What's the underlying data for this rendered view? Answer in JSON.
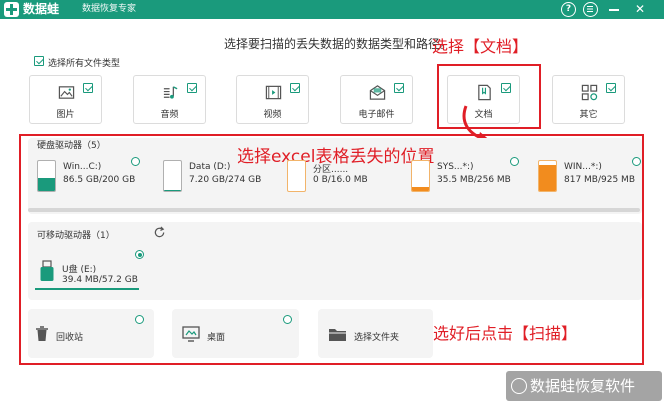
{
  "app": {
    "name": "数据蛙",
    "subtitle": "数据恢复专家"
  },
  "titlebar": {
    "help": "?",
    "close": "✕"
  },
  "instruction": "选择要扫描的丢失数据的数据类型和路径。",
  "annotations": {
    "select_doc": "选择【文档】",
    "select_location": "选择excel表格丢失的位置",
    "click_scan": "选好后点击【扫描】"
  },
  "select_all": "选择所有文件类型",
  "file_types": [
    {
      "label": "图片",
      "icon": "image-icon"
    },
    {
      "label": "音频",
      "icon": "audio-icon"
    },
    {
      "label": "视频",
      "icon": "video-icon"
    },
    {
      "label": "电子邮件",
      "icon": "email-icon"
    },
    {
      "label": "文档",
      "icon": "document-icon"
    },
    {
      "label": "其它",
      "icon": "other-icon"
    }
  ],
  "hard_drives": {
    "title": "硬盘驱动器（5）",
    "items": [
      {
        "name": "Win...C:)",
        "size": "86.5 GB/200 GB",
        "used": 0.43,
        "fill": "#1a9a7c"
      },
      {
        "name": "Data (D:)",
        "size": "7.20 GB/274 GB",
        "used": 0.03,
        "fill": "#1a9a7c"
      },
      {
        "name": "分区......",
        "size": "0 B/16.0 MB",
        "used": 0,
        "fill": "#1a9a7c"
      },
      {
        "name": "SYS...*:)",
        "size": "35.5 MB/256 MB",
        "used": 0.14,
        "fill": "#f28c1e"
      },
      {
        "name": "WIN...*:)",
        "size": "817 MB/925 MB",
        "used": 0.88,
        "fill": "#f28c1e"
      }
    ]
  },
  "removable": {
    "title": "可移动驱动器（1）",
    "items": [
      {
        "name": "U盘 (E:)",
        "size": "39.4 MB/57.2 GB"
      }
    ]
  },
  "locations": [
    {
      "label": "回收站",
      "icon": "recycle-bin-icon"
    },
    {
      "label": "桌面",
      "icon": "desktop-icon"
    },
    {
      "label": "选择文件夹",
      "icon": "folder-icon"
    }
  ],
  "watermark": "数据蛙恢复软件",
  "colors": {
    "accent": "#1a9a7c",
    "annotation": "#e01e26",
    "warning": "#f28c1e"
  }
}
